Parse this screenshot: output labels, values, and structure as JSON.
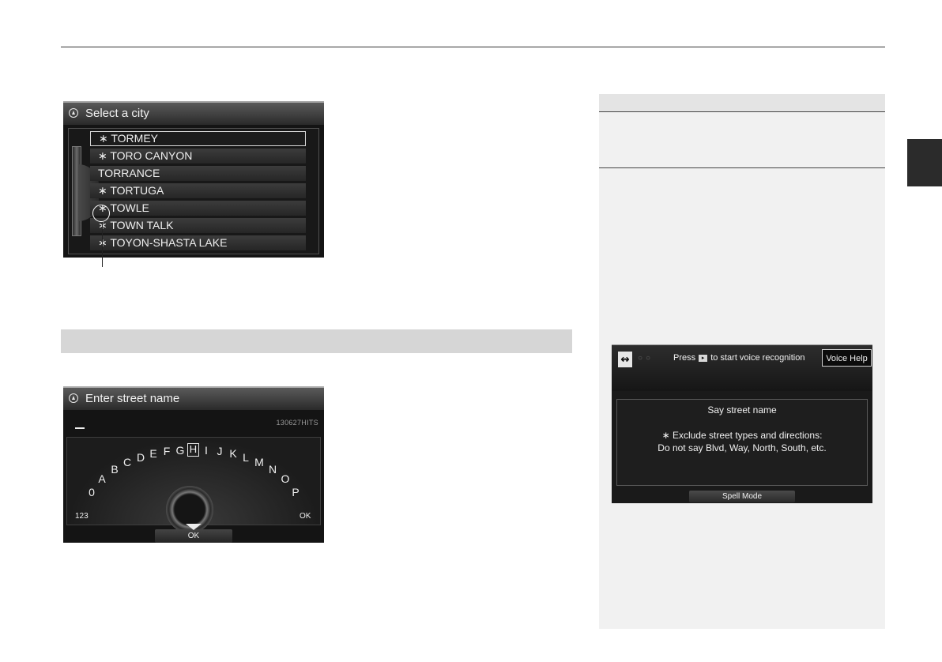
{
  "city_screen": {
    "title": "Select a city",
    "cities": [
      "∗ TORMEY",
      "∗ TORO CANYON",
      "TORRANCE",
      "∗ TORTUGA",
      "∗ TOWLE",
      "∗ TOWN TALK",
      "∗ TOYON-SHASTA LAKE"
    ],
    "selected_index": 0
  },
  "street_screen": {
    "title": "Enter street name",
    "hits": "130627HITS",
    "keys": [
      "0",
      "A",
      "B",
      "C",
      "D",
      "E",
      "F",
      "G",
      "H",
      "I",
      "J",
      "K",
      "L",
      "M",
      "N",
      "O",
      "P"
    ],
    "selected_key": "H",
    "mode_label": "123",
    "right_ok": "OK",
    "ok_label": "OK"
  },
  "voice_screen": {
    "press_before": "Press",
    "talk_icon": "talk-button-icon",
    "press_after": "to start voice recognition",
    "voice_help": "Voice Help",
    "prompt": "Say street name",
    "note_line1": "∗ Exclude street types and directions:",
    "note_line2": "Do not say Blvd, Way, North, South, etc.",
    "spell_mode": "Spell Mode"
  },
  "colors": {
    "screen_bg": "#141414",
    "section_bar": "#d6d6d6",
    "sidebar_bg": "#f1f1f1",
    "chapter_tab": "#2b2b2b"
  }
}
